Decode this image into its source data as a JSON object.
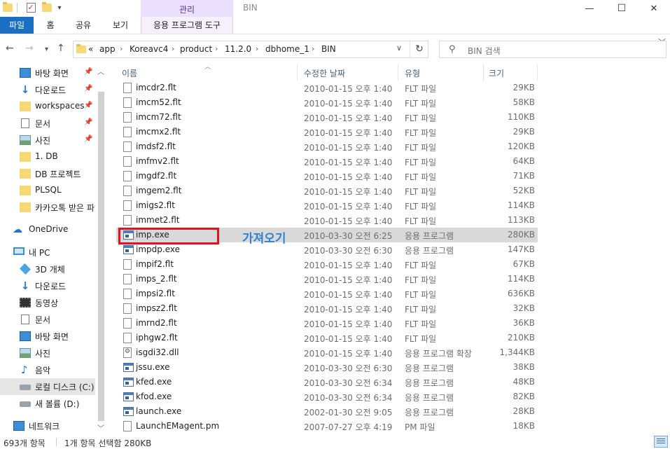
{
  "window": {
    "title": "BIN",
    "context_tab_group": "관리",
    "controls": {
      "minimize": "—",
      "maximize": "☐",
      "close": "✕"
    },
    "quick_access_dropdown": "▾"
  },
  "ribbon": {
    "tabs": [
      {
        "label": "파일",
        "active": true
      },
      {
        "label": "홈"
      },
      {
        "label": "공유"
      },
      {
        "label": "보기"
      },
      {
        "label": "응용 프로그램 도구"
      }
    ],
    "expand_icon": "chevron-down-icon"
  },
  "navigation": {
    "back": "back-arrow-icon",
    "forward": "forward-arrow-icon",
    "recent": "chevron-down-icon",
    "up": "up-arrow-icon"
  },
  "address": {
    "overflow": "«",
    "crumbs": [
      "app",
      "Koreavc4",
      "product",
      "11.2.0",
      "dbhome_1",
      "BIN"
    ],
    "separator": "›"
  },
  "search": {
    "placeholder": "BIN 검색"
  },
  "nav_pane": {
    "items": [
      {
        "label": "바탕 화면",
        "icon": "desktop-icon",
        "pinned": true
      },
      {
        "label": "다운로드",
        "icon": "download-icon",
        "pinned": true
      },
      {
        "label": "workspaces",
        "icon": "folder-icon",
        "pinned": true
      },
      {
        "label": "문서",
        "icon": "document-icon",
        "pinned": true
      },
      {
        "label": "사진",
        "icon": "pictures-icon",
        "pinned": true
      },
      {
        "label": "1. DB",
        "icon": "folder-icon"
      },
      {
        "label": "DB 프로젝트",
        "icon": "folder-icon"
      },
      {
        "label": "PLSQL",
        "icon": "folder-icon"
      },
      {
        "label": "카카오톡 받은 파일",
        "icon": "folder-icon"
      },
      {
        "label": "OneDrive",
        "icon": "onedrive-icon"
      },
      {
        "label": "내 PC",
        "icon": "pc-icon"
      },
      {
        "label": "3D 개체",
        "icon": "3d-objects-icon"
      },
      {
        "label": "다운로드",
        "icon": "download-icon"
      },
      {
        "label": "동영상",
        "icon": "video-icon"
      },
      {
        "label": "문서",
        "icon": "document-icon"
      },
      {
        "label": "바탕 화면",
        "icon": "desktop-icon"
      },
      {
        "label": "사진",
        "icon": "pictures-icon"
      },
      {
        "label": "음악",
        "icon": "music-icon"
      },
      {
        "label": "로컬 디스크 (C:)",
        "icon": "drive-icon",
        "selected": true
      },
      {
        "label": "새 볼륨 (D:)",
        "icon": "drive-icon"
      },
      {
        "label": "네트워크",
        "icon": "network-icon"
      }
    ]
  },
  "columns": {
    "name": "이름",
    "date": "수정한 날짜",
    "type": "유형",
    "size": "크기"
  },
  "files": [
    {
      "name": "imcdr2.flt",
      "date": "2010-01-15 오후 1:40",
      "type": "FLT 파일",
      "size": "29KB",
      "icon": "file-icon"
    },
    {
      "name": "imcm52.flt",
      "date": "2010-01-15 오후 1:40",
      "type": "FLT 파일",
      "size": "58KB",
      "icon": "file-icon"
    },
    {
      "name": "imcm72.flt",
      "date": "2010-01-15 오후 1:40",
      "type": "FLT 파일",
      "size": "110KB",
      "icon": "file-icon"
    },
    {
      "name": "imcmx2.flt",
      "date": "2010-01-15 오후 1:40",
      "type": "FLT 파일",
      "size": "29KB",
      "icon": "file-icon"
    },
    {
      "name": "imdsf2.flt",
      "date": "2010-01-15 오후 1:40",
      "type": "FLT 파일",
      "size": "120KB",
      "icon": "file-icon"
    },
    {
      "name": "imfmv2.flt",
      "date": "2010-01-15 오후 1:40",
      "type": "FLT 파일",
      "size": "64KB",
      "icon": "file-icon"
    },
    {
      "name": "imgdf2.flt",
      "date": "2010-01-15 오후 1:40",
      "type": "FLT 파일",
      "size": "71KB",
      "icon": "file-icon"
    },
    {
      "name": "imgem2.flt",
      "date": "2010-01-15 오후 1:40",
      "type": "FLT 파일",
      "size": "52KB",
      "icon": "file-icon"
    },
    {
      "name": "imigs2.flt",
      "date": "2010-01-15 오후 1:40",
      "type": "FLT 파일",
      "size": "114KB",
      "icon": "file-icon"
    },
    {
      "name": "immet2.flt",
      "date": "2010-01-15 오후 1:40",
      "type": "FLT 파일",
      "size": "113KB",
      "icon": "file-icon"
    },
    {
      "name": "imp.exe",
      "date": "2010-03-30 오전 6:25",
      "type": "응용 프로그램",
      "size": "280KB",
      "icon": "exe-icon",
      "selected": true
    },
    {
      "name": "impdp.exe",
      "date": "2010-03-30 오전 6:30",
      "type": "응용 프로그램",
      "size": "147KB",
      "icon": "exe-icon"
    },
    {
      "name": "impif2.flt",
      "date": "2010-01-15 오후 1:40",
      "type": "FLT 파일",
      "size": "67KB",
      "icon": "file-icon"
    },
    {
      "name": "imps_2.flt",
      "date": "2010-01-15 오후 1:40",
      "type": "FLT 파일",
      "size": "114KB",
      "icon": "file-icon"
    },
    {
      "name": "impsi2.flt",
      "date": "2010-01-15 오후 1:40",
      "type": "FLT 파일",
      "size": "636KB",
      "icon": "file-icon"
    },
    {
      "name": "impsz2.flt",
      "date": "2010-01-15 오후 1:40",
      "type": "FLT 파일",
      "size": "32KB",
      "icon": "file-icon"
    },
    {
      "name": "imrnd2.flt",
      "date": "2010-01-15 오후 1:40",
      "type": "FLT 파일",
      "size": "36KB",
      "icon": "file-icon"
    },
    {
      "name": "iphgw2.flt",
      "date": "2010-01-15 오후 1:40",
      "type": "FLT 파일",
      "size": "210KB",
      "icon": "file-icon"
    },
    {
      "name": "isgdi32.dll",
      "date": "2010-01-15 오후 1:40",
      "type": "응용 프로그램 확장",
      "size": "1,344KB",
      "icon": "dll-icon"
    },
    {
      "name": "jssu.exe",
      "date": "2010-03-30 오전 6:30",
      "type": "응용 프로그램",
      "size": "38KB",
      "icon": "exe-icon"
    },
    {
      "name": "kfed.exe",
      "date": "2010-03-30 오전 6:34",
      "type": "응용 프로그램",
      "size": "48KB",
      "icon": "exe-icon"
    },
    {
      "name": "kfod.exe",
      "date": "2010-03-30 오전 6:34",
      "type": "응용 프로그램",
      "size": "82KB",
      "icon": "exe-icon"
    },
    {
      "name": "launch.exe",
      "date": "2002-01-30 오전 9:05",
      "type": "응용 프로그램",
      "size": "28KB",
      "icon": "exe-icon"
    },
    {
      "name": "LaunchEMagent.pm",
      "date": "2007-07-27 오후 4:19",
      "type": "PM 파일",
      "size": "18KB",
      "icon": "file-icon"
    }
  ],
  "annotation": {
    "text": "가져오기",
    "color": "#2e82d6",
    "box_color": "#e0141e"
  },
  "status": {
    "count": "693개 항목",
    "selection": "1개 항목 선택함 280KB"
  },
  "colors": {
    "file_tab": "#1a6fc4",
    "context_tab": "#eadffc",
    "selected_row": "#d9d9d9"
  }
}
